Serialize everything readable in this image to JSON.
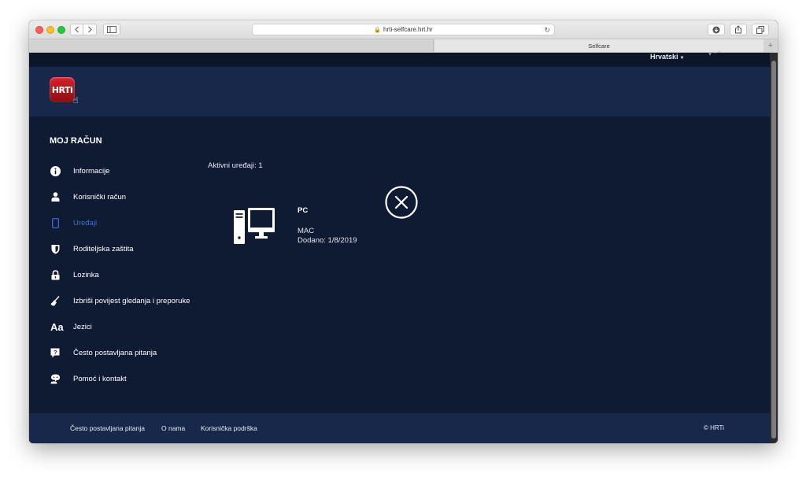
{
  "browser": {
    "url": "hrti-selfcare.hrt.hr",
    "tab_title": "Selfcare"
  },
  "page": {
    "language": "Hrvatski",
    "logo_text": "HRTi",
    "menu": {
      "title": "MOJ RAČUN",
      "items": [
        {
          "label": "Informacije",
          "icon": "info-icon"
        },
        {
          "label": "Korisnički račun",
          "icon": "user-icon"
        },
        {
          "label": "Uređaji",
          "icon": "device-icon",
          "active": true
        },
        {
          "label": "Roditeljska zaštita",
          "icon": "shield-icon"
        },
        {
          "label": "Lozinka",
          "icon": "lock-icon"
        },
        {
          "label": "Izbriši povijest gledanja i preporuke",
          "icon": "broom-icon"
        },
        {
          "label": "Jezici",
          "icon": "language-icon"
        },
        {
          "label": "Često postavljana pitanja",
          "icon": "faq-icon"
        },
        {
          "label": "Pomoć i kontakt",
          "icon": "support-icon"
        }
      ]
    },
    "devices": {
      "active_label": "Aktivni uređaji: 1",
      "list": [
        {
          "name": "PC",
          "type": "MAC",
          "added": "Dodano:  1/8/2019"
        }
      ]
    },
    "footer": {
      "faq": "Često postavljana pitanja",
      "about": "O nama",
      "support": "Korisnička podrška",
      "copyright": "© HRTi"
    }
  },
  "colors": {
    "background": "#0f1b33",
    "header": "#18284b",
    "active_menu": "#3f6fe0"
  }
}
